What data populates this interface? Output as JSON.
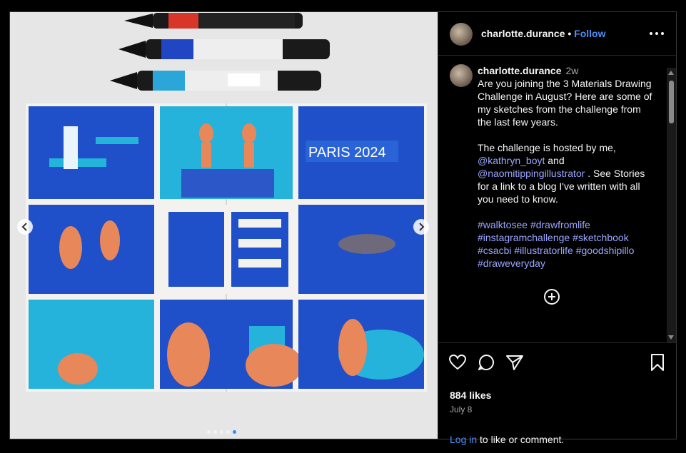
{
  "post": {
    "username": "charlotte.durance",
    "separator": "•",
    "follow_label": "Follow",
    "time_ago": "2w",
    "caption_lines": [
      "Are you joining the 3 Materials Drawing Challenge in August? Here are some of my sketches from the challenge from the last few years."
    ],
    "caption_p2_a": "The challenge is hosted by me,",
    "mention1": "@kathryn_boyt",
    "and": " and",
    "mention2": "@naomitippingillustrator",
    "caption_p2_b": " . See Stories for a link to a blog I've written with all you need to know.",
    "hashtags": [
      "#walktosee",
      "#drawfromlife",
      "#instagramchallenge",
      "#sketchbook",
      "#csacbi",
      "#illustratorlife",
      "#goodshipillo",
      "#draweveryday"
    ],
    "likes": "884 likes",
    "date": "July 8",
    "login_link": "Log in",
    "login_rest": " to like or comment."
  },
  "image": {
    "sign_text": "PARIS 2024"
  },
  "colors": {
    "accent": "#4a8ff5",
    "hashtag": "#9aa6ff",
    "royal_blue": "#1f4fc9",
    "turquoise": "#25b3dc",
    "skin": "#e8875a"
  },
  "icons": [
    "more-icon",
    "heart-icon",
    "comment-icon",
    "share-icon",
    "bookmark-icon",
    "add-comment-icon",
    "chevron-left-icon",
    "chevron-right-icon"
  ],
  "carousel": {
    "count": 5,
    "active": 4
  }
}
